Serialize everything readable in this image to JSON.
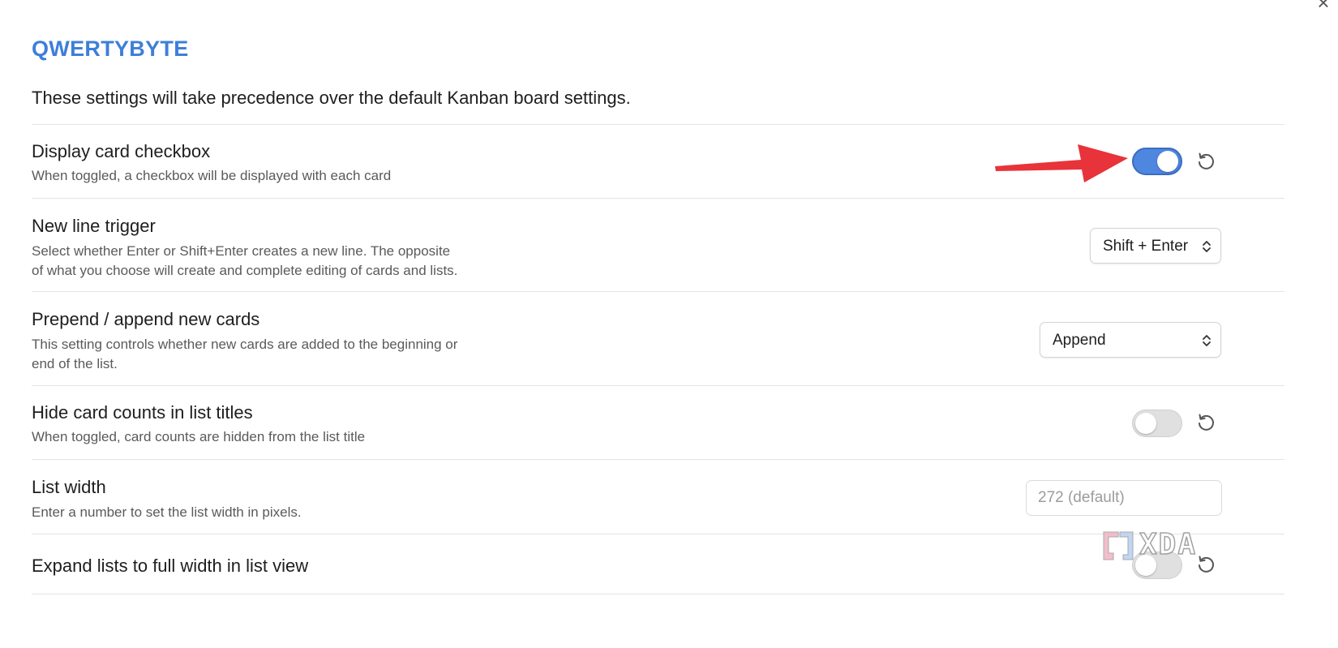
{
  "window": {
    "close_icon": "close-icon"
  },
  "header": {
    "title": "QWERTYBYTE",
    "intro": "These settings will take precedence over the default Kanban board settings.",
    "title_color": "#3d7fd9"
  },
  "settings": [
    {
      "title": "Display card checkbox",
      "description": "When toggled, a checkbox will be displayed with each card",
      "control": "toggle",
      "enabled": true,
      "reset_icon": "reset-icon"
    },
    {
      "title": "New line trigger",
      "description_lines": [
        "Select whether Enter or Shift+Enter creates a new line. The opposite",
        "of what you choose will create and complete editing of cards and lists."
      ],
      "control": "select",
      "value": "Shift + Enter"
    },
    {
      "title": "Prepend / append new cards",
      "description_lines": [
        "This setting controls whether new cards are added to the beginning or",
        "end of the list."
      ],
      "control": "select",
      "value": "Append"
    },
    {
      "title": "Hide card counts in list titles",
      "description": "When toggled, card counts are hidden from the list title",
      "control": "toggle",
      "enabled": false,
      "reset_icon": "reset-icon"
    },
    {
      "title": "List width",
      "description": "Enter a number to set the list width in pixels.",
      "control": "number-input",
      "value": "",
      "placeholder": "272 (default)"
    },
    {
      "title": "Expand lists to full width in list view",
      "control": "toggle",
      "enabled": false,
      "reset_icon": "reset-icon"
    }
  ],
  "annotation": {
    "arrow_color": "#e8333a",
    "target": "Display card checkbox toggle"
  },
  "watermark": {
    "text": "XDA"
  },
  "colors": {
    "toggle_on": "#4f86e0",
    "toggle_off": "#e0e0e0",
    "divider": "#e4e4e4"
  }
}
